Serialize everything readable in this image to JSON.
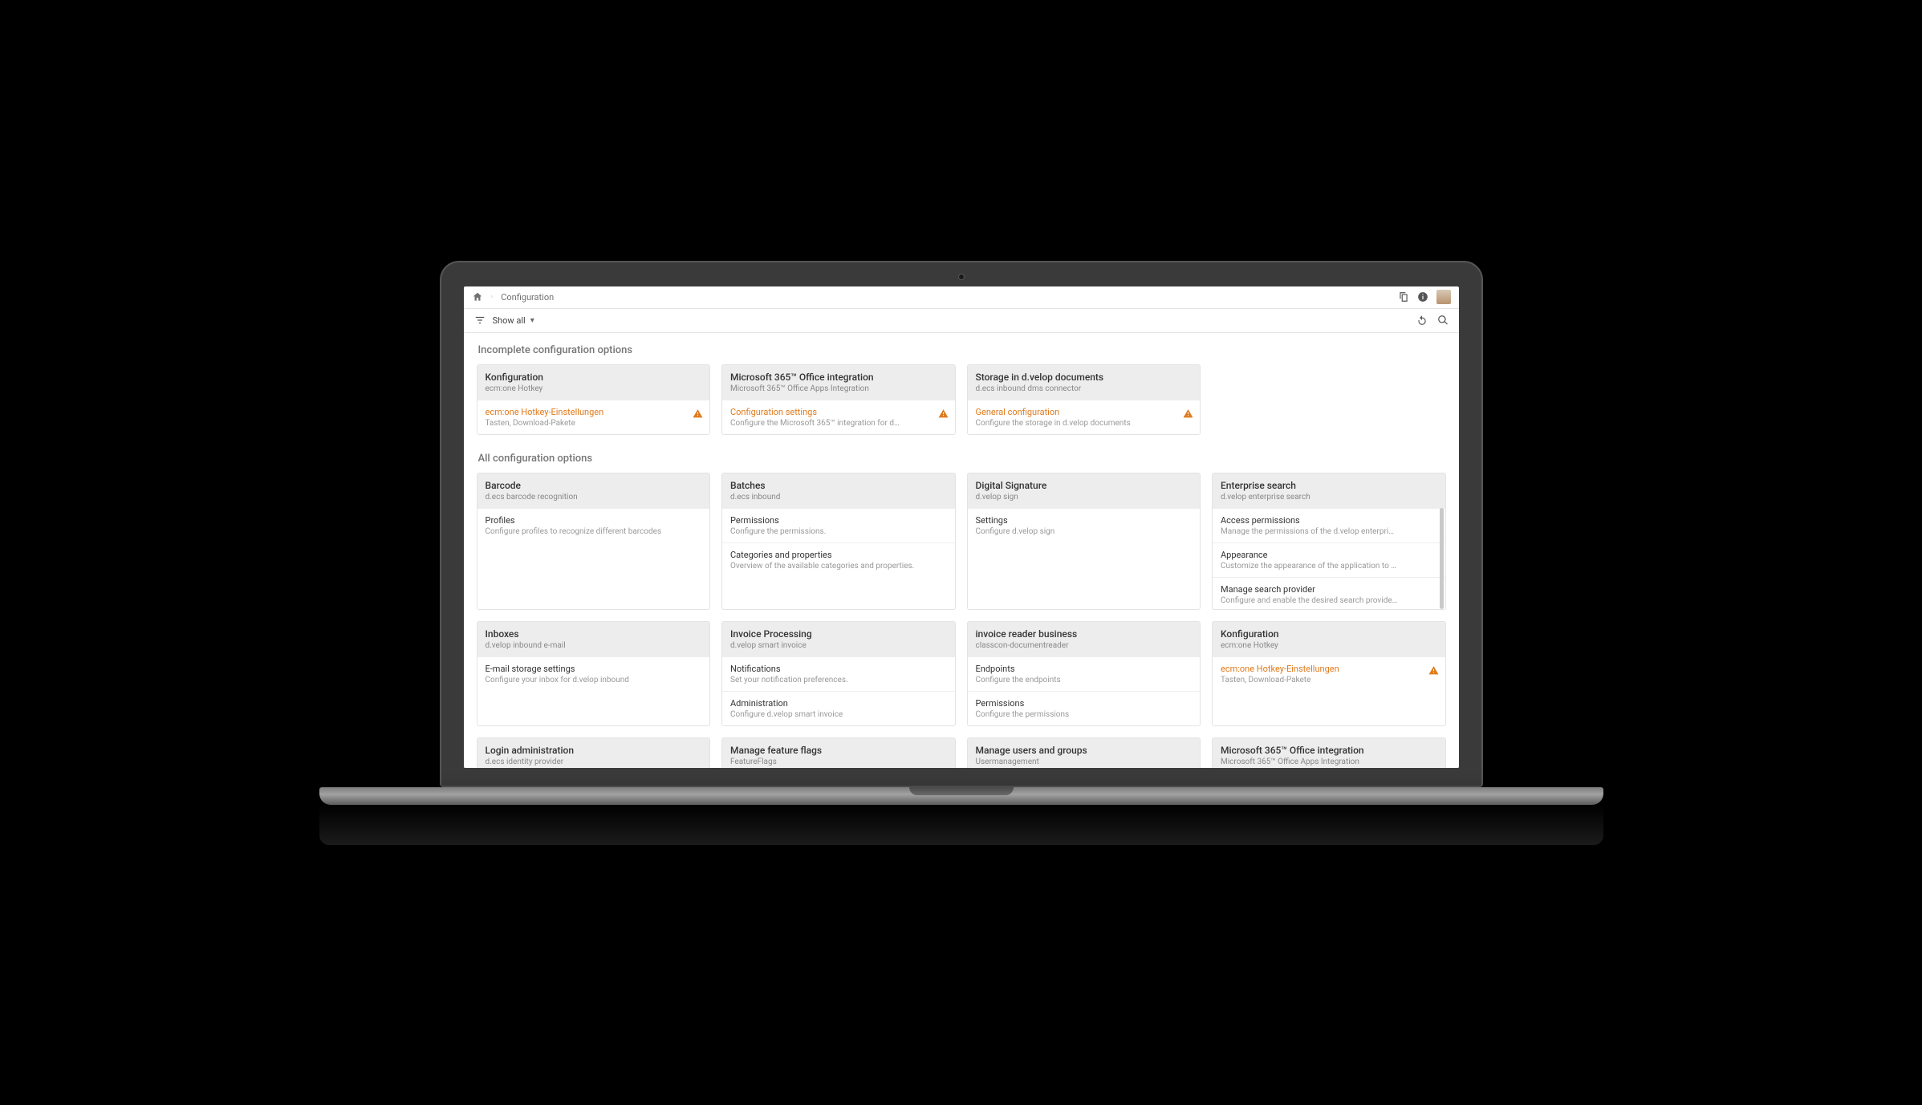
{
  "header": {
    "breadcrumb": "Configuration"
  },
  "filter": {
    "label": "Show all"
  },
  "sections": {
    "incomplete_title": "Incomplete configuration options",
    "all_title": "All configuration options"
  },
  "incomplete": [
    {
      "title": "Konfiguration",
      "sub": "ecm:one Hotkey",
      "items": [
        {
          "title": "ecm:one Hotkey-Einstellungen",
          "sub": "Tasten, Download-Pakete",
          "warn": true
        }
      ]
    },
    {
      "title": "Microsoft 365™ Office integration",
      "sub": "Microsoft 365™ Office Apps Integration",
      "items": [
        {
          "title": "Configuration settings",
          "sub": "Configure the Microsoft 365™ integration for d…",
          "warn": true
        }
      ]
    },
    {
      "title": "Storage in d.velop documents",
      "sub": "d.ecs inbound dms connector",
      "items": [
        {
          "title": "General configuration",
          "sub": "Configure the storage in d.velop documents",
          "warn": true
        }
      ]
    }
  ],
  "all": [
    {
      "title": "Barcode",
      "sub": "d.ecs barcode recognition",
      "items": [
        {
          "title": "Profiles",
          "sub": "Configure profiles to recognize different barcodes"
        }
      ]
    },
    {
      "title": "Batches",
      "sub": "d.ecs inbound",
      "items": [
        {
          "title": "Permissions",
          "sub": "Configure the permissions."
        },
        {
          "title": "Categories and properties",
          "sub": "Overview of the available categories and properties."
        }
      ]
    },
    {
      "title": "Digital Signature",
      "sub": "d.velop sign",
      "items": [
        {
          "title": "Settings",
          "sub": "Configure d.velop sign"
        }
      ]
    },
    {
      "title": "Enterprise search",
      "sub": "d.velop enterprise search",
      "scroll": true,
      "items": [
        {
          "title": "Access permissions",
          "sub": "Manage the permissions of the d.velop enterpri…"
        },
        {
          "title": "Appearance",
          "sub": "Customize the appearance of the application to …"
        },
        {
          "title": "Manage search provider",
          "sub": "Configure and enable the desired search provide…"
        }
      ]
    },
    {
      "title": "Inboxes",
      "sub": "d.velop inbound e-mail",
      "items": [
        {
          "title": "E-mail storage settings",
          "sub": "Configure your inbox for d.velop inbound"
        }
      ]
    },
    {
      "title": "Invoice Processing",
      "sub": "d.velop smart invoice",
      "items": [
        {
          "title": "Notifications",
          "sub": "Set your notification preferences."
        },
        {
          "title": "Administration",
          "sub": "Configure d.velop smart invoice"
        }
      ]
    },
    {
      "title": "invoice reader business",
      "sub": "classcon-documentreader",
      "items": [
        {
          "title": "Endpoints",
          "sub": "Configure the endpoints"
        },
        {
          "title": "Permissions",
          "sub": "Configure the permissions"
        }
      ]
    },
    {
      "title": "Konfiguration",
      "sub": "ecm:one Hotkey",
      "items": [
        {
          "title": "ecm:one Hotkey-Einstellungen",
          "sub": "Tasten, Download-Pakete",
          "warn": true
        }
      ]
    },
    {
      "title": "Login administration",
      "sub": "d.ecs identity provider",
      "items": []
    },
    {
      "title": "Manage feature flags",
      "sub": "FeatureFlags",
      "items": []
    },
    {
      "title": "Manage users and groups",
      "sub": "Usermanagement",
      "items": []
    },
    {
      "title": "Microsoft 365™ Office integration",
      "sub": "Microsoft 365™ Office Apps Integration",
      "items": []
    }
  ]
}
